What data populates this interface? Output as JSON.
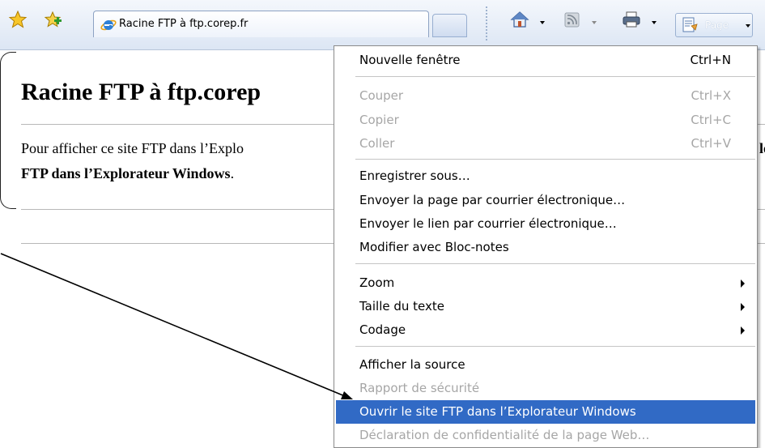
{
  "toolbar": {
    "tab_title": "Racine FTP à ftp.corep.fr",
    "page_button_label": "Page",
    "icons": [
      "favorites-star-icon",
      "add-favorite-icon",
      "ie-icon",
      "home-icon",
      "feeds-icon",
      "print-icon",
      "page-icon"
    ]
  },
  "page": {
    "heading": "Racine FTP à ftp.corep",
    "body_line1": "Pour afficher ce site FTP dans l’Explo",
    "body_line2_bold": "FTP dans l’Explorateur Windows",
    "body_line2_end": ".",
    "right_fragment": "le"
  },
  "menu": {
    "items": [
      {
        "label": "Nouvelle fenêtre",
        "shortcut": "Ctrl+N",
        "disabled": false
      },
      {
        "label": "Couper",
        "shortcut": "Ctrl+X",
        "disabled": true
      },
      {
        "label": "Copier",
        "shortcut": "Ctrl+C",
        "disabled": true
      },
      {
        "label": "Coller",
        "shortcut": "Ctrl+V",
        "disabled": true
      },
      {
        "label": "Enregistrer sous…",
        "shortcut": "",
        "disabled": false
      },
      {
        "label": "Envoyer la page par courrier électronique…",
        "shortcut": "",
        "disabled": false
      },
      {
        "label": "Envoyer le lien par courrier électronique…",
        "shortcut": "",
        "disabled": false
      },
      {
        "label": "Modifier avec Bloc-notes",
        "shortcut": "",
        "disabled": false
      },
      {
        "label": "Zoom",
        "shortcut": "",
        "disabled": false,
        "submenu": true
      },
      {
        "label": "Taille du texte",
        "shortcut": "",
        "disabled": false,
        "submenu": true
      },
      {
        "label": "Codage",
        "shortcut": "",
        "disabled": false,
        "submenu": true
      },
      {
        "label": "Afficher la source",
        "shortcut": "",
        "disabled": false
      },
      {
        "label": "Rapport de sécurité",
        "shortcut": "",
        "disabled": true
      },
      {
        "label": "Ouvrir le site FTP dans l’Explorateur Windows",
        "shortcut": "",
        "disabled": false,
        "highlighted": true
      },
      {
        "label": "Déclaration de confidentialité de la page Web…",
        "shortcut": "",
        "disabled": true
      }
    ]
  },
  "colors": {
    "highlight": "#316ac5",
    "disabled_text": "#a6a6a6",
    "toolbar_bg": "#dce6f4"
  }
}
